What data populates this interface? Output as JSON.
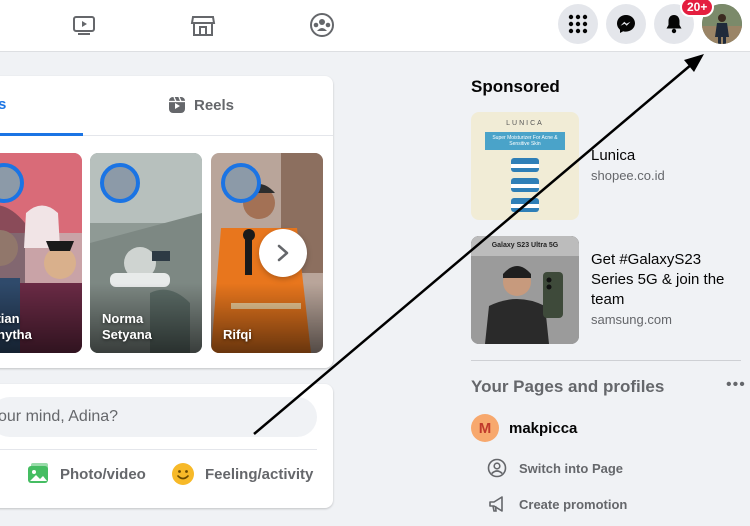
{
  "topnav": {
    "icons": [
      "watch-icon",
      "marketplace-icon",
      "groups-icon"
    ],
    "right_buttons": [
      "menu-grid-icon",
      "messenger-icon",
      "notifications-icon"
    ],
    "notification_badge": "20+"
  },
  "stories_card": {
    "tabs": [
      {
        "label": "s",
        "active": true
      },
      {
        "label": "Reels",
        "active": false
      }
    ],
    "stories": [
      {
        "name": "vetian\nsphytha"
      },
      {
        "name": "Norma\nSetyana"
      },
      {
        "name": "Rifqi"
      }
    ]
  },
  "composer": {
    "placeholder": "our mind, Adina?",
    "actions": [
      {
        "label": "Photo/video"
      },
      {
        "label": "Feeling/activity"
      }
    ]
  },
  "sidebar": {
    "sponsored_title": "Sponsored",
    "ads": [
      {
        "headline": "Lunica",
        "domain": "shopee.co.id",
        "image_text": "LUNICA",
        "image_caption": "Super Moisturizer For Acne & Sensitive Skin"
      },
      {
        "headline": "Get #GalaxyS23 Series 5G & join the team",
        "domain": "samsung.com",
        "image_text": "Galaxy S23 Ultra 5G"
      }
    ],
    "pages_title": "Your Pages and profiles",
    "page": {
      "initial": "M",
      "name": "makpicca"
    },
    "page_actions": [
      {
        "label": "Switch into Page"
      },
      {
        "label": "Create promotion"
      }
    ]
  },
  "colors": {
    "accent": "#1b74e4",
    "badge": "#e41e3f",
    "background": "#f0f2f5"
  }
}
